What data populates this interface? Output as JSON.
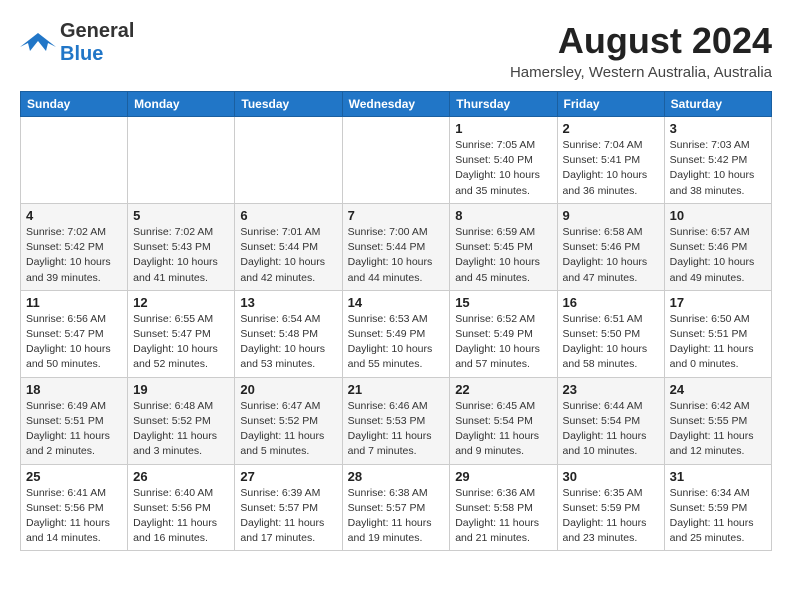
{
  "header": {
    "logo_general": "General",
    "logo_blue": "Blue",
    "month_year": "August 2024",
    "location": "Hamersley, Western Australia, Australia"
  },
  "days_of_week": [
    "Sunday",
    "Monday",
    "Tuesday",
    "Wednesday",
    "Thursday",
    "Friday",
    "Saturday"
  ],
  "weeks": [
    [
      {
        "day": "",
        "info": ""
      },
      {
        "day": "",
        "info": ""
      },
      {
        "day": "",
        "info": ""
      },
      {
        "day": "",
        "info": ""
      },
      {
        "day": "1",
        "info": "Sunrise: 7:05 AM\nSunset: 5:40 PM\nDaylight: 10 hours\nand 35 minutes."
      },
      {
        "day": "2",
        "info": "Sunrise: 7:04 AM\nSunset: 5:41 PM\nDaylight: 10 hours\nand 36 minutes."
      },
      {
        "day": "3",
        "info": "Sunrise: 7:03 AM\nSunset: 5:42 PM\nDaylight: 10 hours\nand 38 minutes."
      }
    ],
    [
      {
        "day": "4",
        "info": "Sunrise: 7:02 AM\nSunset: 5:42 PM\nDaylight: 10 hours\nand 39 minutes."
      },
      {
        "day": "5",
        "info": "Sunrise: 7:02 AM\nSunset: 5:43 PM\nDaylight: 10 hours\nand 41 minutes."
      },
      {
        "day": "6",
        "info": "Sunrise: 7:01 AM\nSunset: 5:44 PM\nDaylight: 10 hours\nand 42 minutes."
      },
      {
        "day": "7",
        "info": "Sunrise: 7:00 AM\nSunset: 5:44 PM\nDaylight: 10 hours\nand 44 minutes."
      },
      {
        "day": "8",
        "info": "Sunrise: 6:59 AM\nSunset: 5:45 PM\nDaylight: 10 hours\nand 45 minutes."
      },
      {
        "day": "9",
        "info": "Sunrise: 6:58 AM\nSunset: 5:46 PM\nDaylight: 10 hours\nand 47 minutes."
      },
      {
        "day": "10",
        "info": "Sunrise: 6:57 AM\nSunset: 5:46 PM\nDaylight: 10 hours\nand 49 minutes."
      }
    ],
    [
      {
        "day": "11",
        "info": "Sunrise: 6:56 AM\nSunset: 5:47 PM\nDaylight: 10 hours\nand 50 minutes."
      },
      {
        "day": "12",
        "info": "Sunrise: 6:55 AM\nSunset: 5:47 PM\nDaylight: 10 hours\nand 52 minutes."
      },
      {
        "day": "13",
        "info": "Sunrise: 6:54 AM\nSunset: 5:48 PM\nDaylight: 10 hours\nand 53 minutes."
      },
      {
        "day": "14",
        "info": "Sunrise: 6:53 AM\nSunset: 5:49 PM\nDaylight: 10 hours\nand 55 minutes."
      },
      {
        "day": "15",
        "info": "Sunrise: 6:52 AM\nSunset: 5:49 PM\nDaylight: 10 hours\nand 57 minutes."
      },
      {
        "day": "16",
        "info": "Sunrise: 6:51 AM\nSunset: 5:50 PM\nDaylight: 10 hours\nand 58 minutes."
      },
      {
        "day": "17",
        "info": "Sunrise: 6:50 AM\nSunset: 5:51 PM\nDaylight: 11 hours\nand 0 minutes."
      }
    ],
    [
      {
        "day": "18",
        "info": "Sunrise: 6:49 AM\nSunset: 5:51 PM\nDaylight: 11 hours\nand 2 minutes."
      },
      {
        "day": "19",
        "info": "Sunrise: 6:48 AM\nSunset: 5:52 PM\nDaylight: 11 hours\nand 3 minutes."
      },
      {
        "day": "20",
        "info": "Sunrise: 6:47 AM\nSunset: 5:52 PM\nDaylight: 11 hours\nand 5 minutes."
      },
      {
        "day": "21",
        "info": "Sunrise: 6:46 AM\nSunset: 5:53 PM\nDaylight: 11 hours\nand 7 minutes."
      },
      {
        "day": "22",
        "info": "Sunrise: 6:45 AM\nSunset: 5:54 PM\nDaylight: 11 hours\nand 9 minutes."
      },
      {
        "day": "23",
        "info": "Sunrise: 6:44 AM\nSunset: 5:54 PM\nDaylight: 11 hours\nand 10 minutes."
      },
      {
        "day": "24",
        "info": "Sunrise: 6:42 AM\nSunset: 5:55 PM\nDaylight: 11 hours\nand 12 minutes."
      }
    ],
    [
      {
        "day": "25",
        "info": "Sunrise: 6:41 AM\nSunset: 5:56 PM\nDaylight: 11 hours\nand 14 minutes."
      },
      {
        "day": "26",
        "info": "Sunrise: 6:40 AM\nSunset: 5:56 PM\nDaylight: 11 hours\nand 16 minutes."
      },
      {
        "day": "27",
        "info": "Sunrise: 6:39 AM\nSunset: 5:57 PM\nDaylight: 11 hours\nand 17 minutes."
      },
      {
        "day": "28",
        "info": "Sunrise: 6:38 AM\nSunset: 5:57 PM\nDaylight: 11 hours\nand 19 minutes."
      },
      {
        "day": "29",
        "info": "Sunrise: 6:36 AM\nSunset: 5:58 PM\nDaylight: 11 hours\nand 21 minutes."
      },
      {
        "day": "30",
        "info": "Sunrise: 6:35 AM\nSunset: 5:59 PM\nDaylight: 11 hours\nand 23 minutes."
      },
      {
        "day": "31",
        "info": "Sunrise: 6:34 AM\nSunset: 5:59 PM\nDaylight: 11 hours\nand 25 minutes."
      }
    ]
  ]
}
